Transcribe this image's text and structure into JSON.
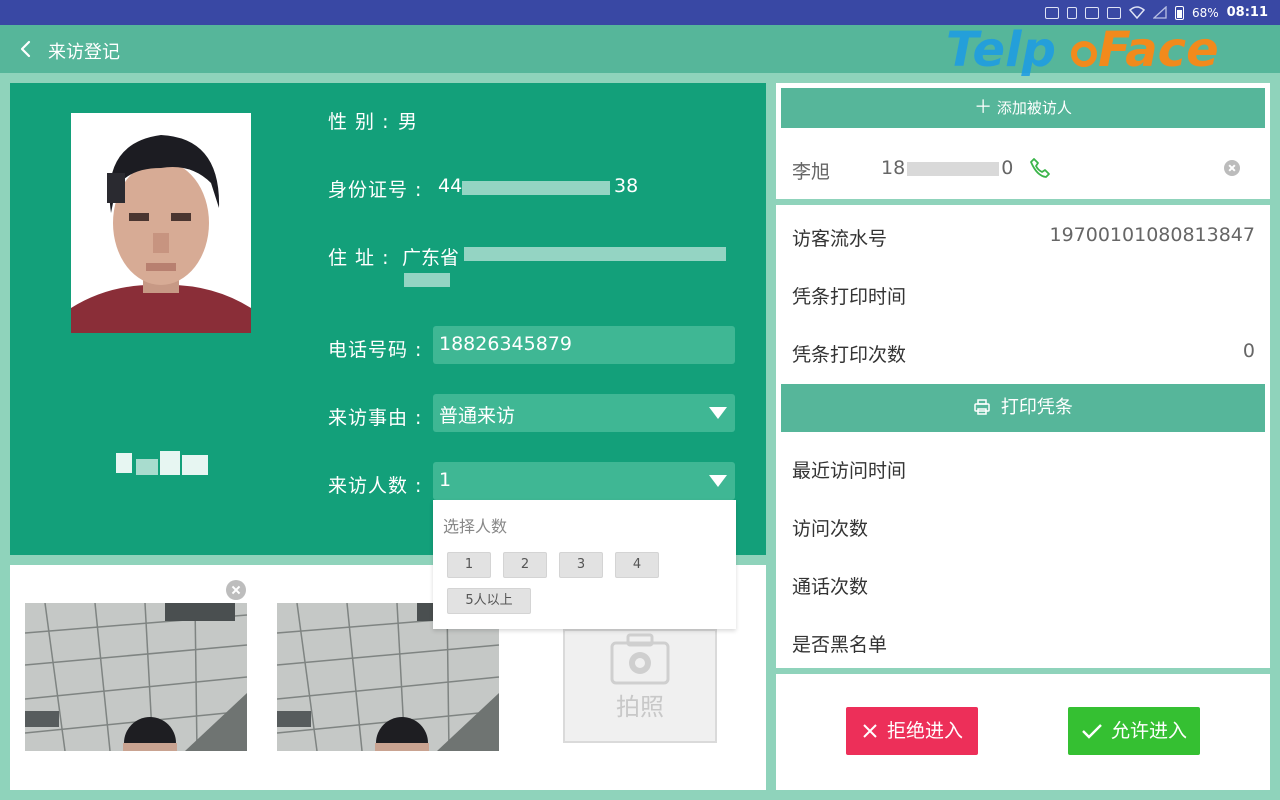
{
  "status_bar": {
    "battery": "68%",
    "time": "08:11",
    "icons": [
      "cast-icon",
      "vibrate-icon",
      "gallery-icon",
      "car-icon",
      "wifi-icon",
      "signal-icon",
      "battery-icon"
    ]
  },
  "title_bar": {
    "back_icon": "back-arrow-icon",
    "title": "来访登记",
    "brand_logo": "TelpoFace"
  },
  "visitor": {
    "gender_label": "性 别 :",
    "gender_value": "男",
    "id_label": "身份证号 :",
    "id_value_start": "44",
    "id_value_end": "38",
    "address_label": "住 址 :",
    "address_value_start": "广东省",
    "phone_label": "电话号码 :",
    "phone_value": "18826345879",
    "reason_label": "来访事由 :",
    "reason_value": "普通来访",
    "count_label": "来访人数 :",
    "count_value": "1"
  },
  "count_popup": {
    "title": "选择人数",
    "options": [
      "1",
      "2",
      "3",
      "4",
      "5人以上"
    ]
  },
  "capture": {
    "photo_button_label": "拍照",
    "shots": 2
  },
  "host": {
    "add_button": "添加被访人",
    "name": "李旭",
    "phone_start": "18",
    "phone_end": "0"
  },
  "details": {
    "serial_label": "访客流水号",
    "serial_value": "19700101080813847",
    "print_time_label": "凭条打印时间",
    "print_count_label": "凭条打印次数",
    "print_count_value": "0",
    "print_button": "打印凭条",
    "last_visit_label": "最近访问时间",
    "visit_count_label": "访问次数",
    "call_count_label": "通话次数",
    "blacklist_label": "是否黑名单"
  },
  "actions": {
    "reject": "拒绝进入",
    "allow": "允许进入"
  },
  "colors": {
    "status_bar": "#3948a4",
    "title_bar": "#56b69a",
    "info_panel": "#13a07a",
    "input_bg": "#3fb794",
    "reject": "#ed2f59",
    "allow": "#35c032",
    "logo_blue": "#1c9be6",
    "logo_orange": "#f28a1c"
  }
}
